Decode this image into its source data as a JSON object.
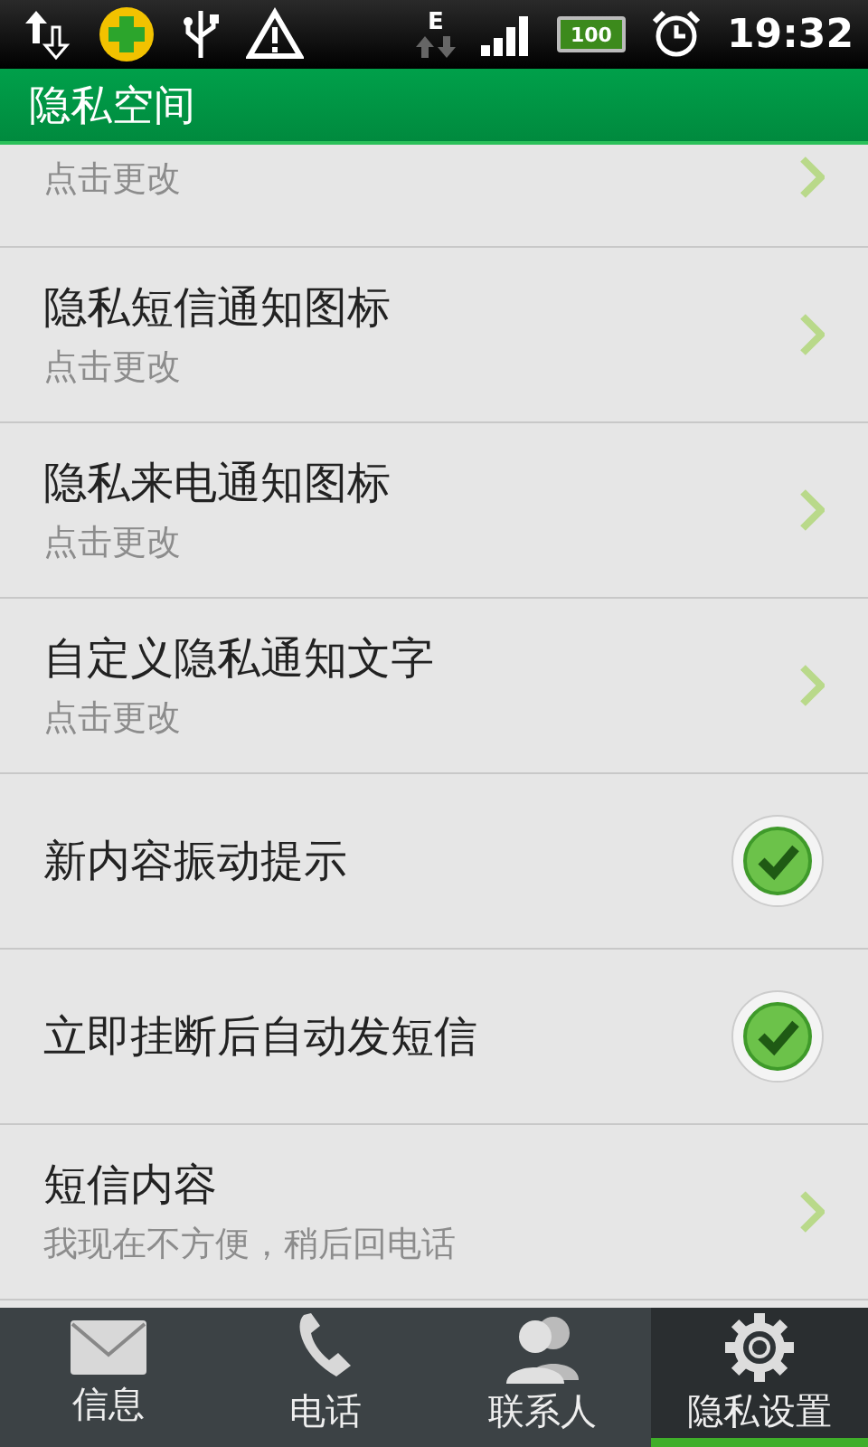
{
  "status_bar": {
    "network": "E",
    "battery": "100",
    "time": "19:32"
  },
  "header": {
    "title": "隐私空间"
  },
  "items": [
    {
      "kind": "link",
      "subtitle": "点击更改"
    },
    {
      "kind": "link",
      "title": "隐私短信通知图标",
      "subtitle": "点击更改"
    },
    {
      "kind": "link",
      "title": "隐私来电通知图标",
      "subtitle": "点击更改"
    },
    {
      "kind": "link",
      "title": "自定义隐私通知文字",
      "subtitle": "点击更改"
    },
    {
      "kind": "toggle",
      "title": "新内容振动提示",
      "checked": true
    },
    {
      "kind": "toggle",
      "title": "立即挂断后自动发短信",
      "checked": true
    },
    {
      "kind": "link",
      "title": "短信内容",
      "subtitle": "我现在不方便，稍后回电话"
    }
  ],
  "tabs": [
    {
      "label": "信息",
      "selected": false
    },
    {
      "label": "电话",
      "selected": false
    },
    {
      "label": "联系人",
      "selected": false
    },
    {
      "label": "隐私设置",
      "selected": true
    }
  ]
}
